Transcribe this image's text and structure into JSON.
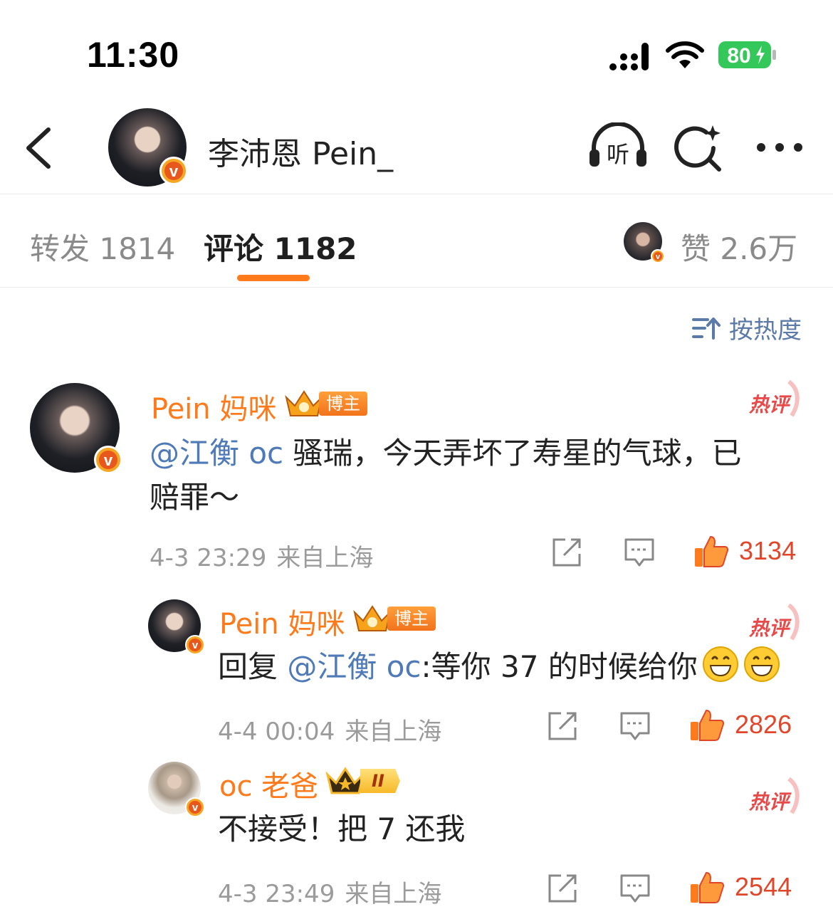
{
  "status_bar": {
    "time": "11:30",
    "battery": "80"
  },
  "header": {
    "title": "李沛恩 Pein_",
    "listen_label": "听"
  },
  "tabs": {
    "forward": "转发 1814",
    "comments": "评论 1182",
    "likes": "赞 2.6万"
  },
  "sort": {
    "label": "按热度"
  },
  "colors": {
    "accent": "#ff7a1a",
    "mention": "#4f7ab8",
    "like": "#e0462a",
    "sort": "#5b7aa8"
  },
  "comments": [
    {
      "username": "Pein 妈咪",
      "badge": "博主",
      "hot": "热评",
      "mention": "@江衡 oc",
      "text_line1": " 骚瑞，今天弄坏了寿星的气球，已",
      "text_line2": "赔罪～",
      "time": "4-3 23:29",
      "location": "来自上海",
      "likes": "3134"
    },
    {
      "username": "Pein 妈咪",
      "badge": "博主",
      "hot": "热评",
      "prefix": "回复 ",
      "mention": "@江衡 oc",
      "text": ":等你 37 的时候给你",
      "time": "4-4 00:04",
      "location": "来自上海",
      "likes": "2826"
    },
    {
      "username": "oc 老爸",
      "level": "II",
      "hot": "热评",
      "text": "不接受！把 7 还我",
      "time": "4-3 23:49",
      "location": "来自上海",
      "likes": "2544"
    }
  ]
}
